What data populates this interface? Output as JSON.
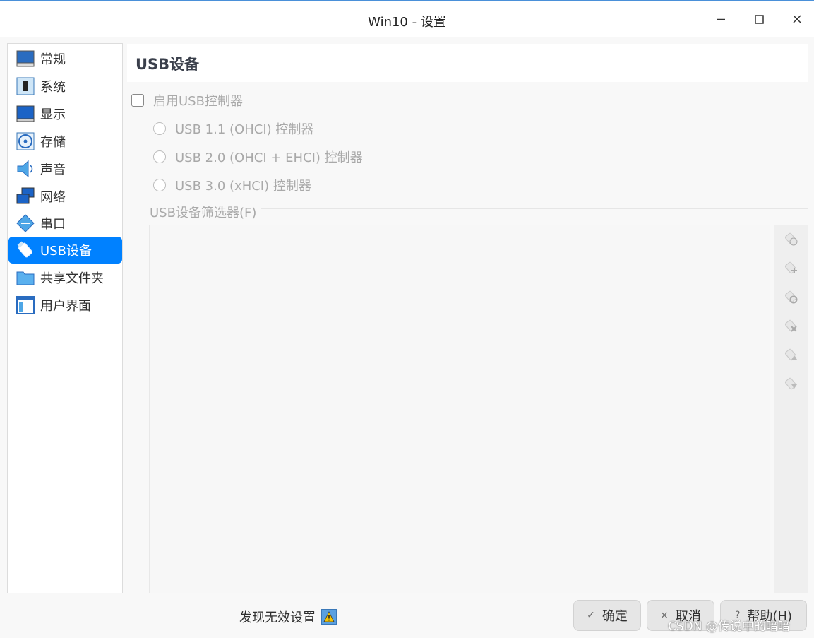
{
  "window": {
    "title": "Win10 - 设置"
  },
  "window_controls": {
    "minimize": "minimize-icon",
    "maximize": "maximize-icon",
    "close": "close-icon"
  },
  "sidebar": {
    "items": [
      {
        "label": "常规",
        "icon": "general-monitor-icon"
      },
      {
        "label": "系统",
        "icon": "chip-icon"
      },
      {
        "label": "显示",
        "icon": "display-icon"
      },
      {
        "label": "存储",
        "icon": "disk-icon"
      },
      {
        "label": "声音",
        "icon": "speaker-icon"
      },
      {
        "label": "网络",
        "icon": "network-icon"
      },
      {
        "label": "串口",
        "icon": "serial-port-icon"
      },
      {
        "label": "USB设备",
        "icon": "usb-icon",
        "active": true
      },
      {
        "label": "共享文件夹",
        "icon": "folder-icon"
      },
      {
        "label": "用户界面",
        "icon": "ui-window-icon"
      }
    ]
  },
  "main": {
    "section_title": "USB设备",
    "enable_usb": {
      "label": "启用USB控制器",
      "checked": false
    },
    "controllers": [
      {
        "label": "USB 1.1 (OHCI) 控制器",
        "selected": false
      },
      {
        "label": "USB 2.0 (OHCI + EHCI) 控制器",
        "selected": false
      },
      {
        "label": "USB 3.0 (xHCI) 控制器",
        "selected": false
      }
    ],
    "filter_group_label": "USB设备筛选器(F)",
    "filter_tools": [
      "add-empty-filter-icon",
      "add-device-filter-icon",
      "edit-filter-icon",
      "remove-filter-icon",
      "move-up-icon",
      "move-down-icon"
    ]
  },
  "footer": {
    "status_text": "发现无效设置",
    "status_icon": "warning-icon",
    "ok_label": "确定",
    "cancel_label": "取消",
    "help_label": "帮助(H)",
    "watermark": "CSDN @传说中的暗暗"
  },
  "colors": {
    "accent": "#0081ff",
    "disabled_text": "#a9a9a9"
  }
}
